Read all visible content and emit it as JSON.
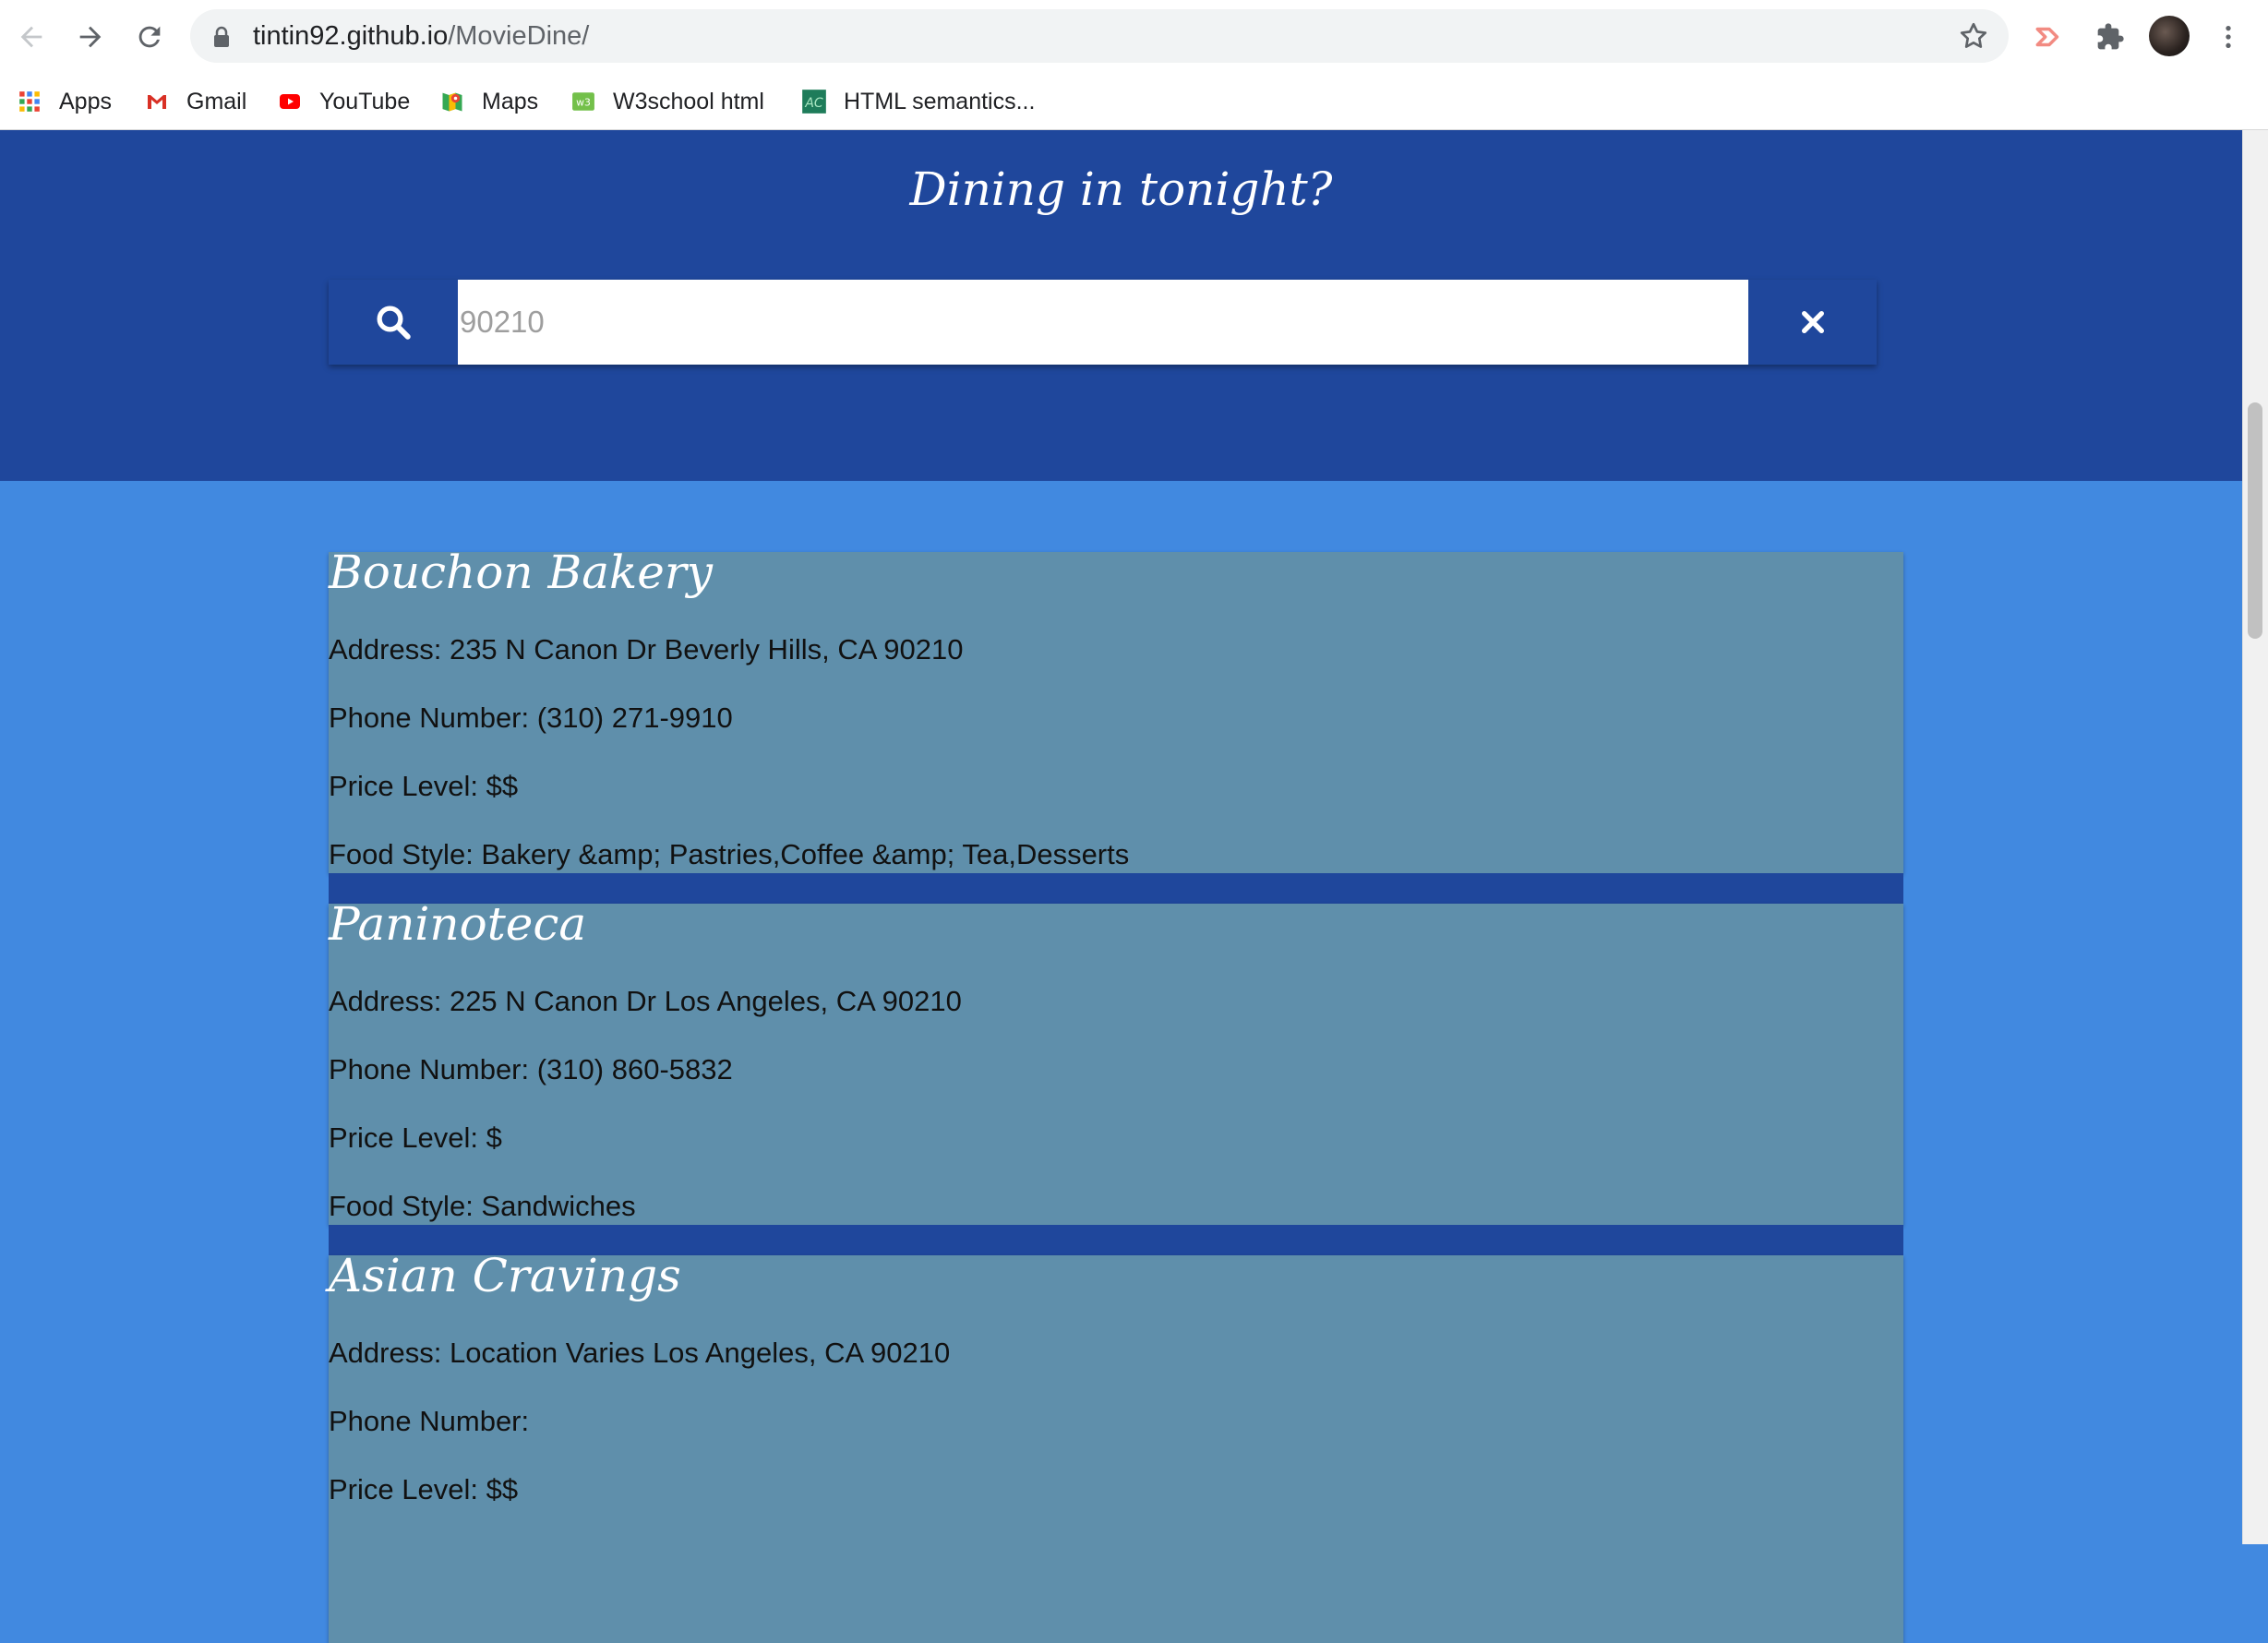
{
  "browser": {
    "url_host": "tintin92.github.io",
    "url_path": "/MovieDine/",
    "bookmarks": [
      {
        "label": "Apps",
        "icon": "apps-grid-icon"
      },
      {
        "label": "Gmail",
        "icon": "gmail-icon"
      },
      {
        "label": "YouTube",
        "icon": "youtube-icon"
      },
      {
        "label": "Maps",
        "icon": "maps-icon"
      },
      {
        "label": "W3school html",
        "icon": "w3schools-icon"
      },
      {
        "label": "HTML semantics...",
        "icon": "html-semantics-icon"
      }
    ]
  },
  "page": {
    "title": "Dining in tonight?",
    "search": {
      "placeholder": "90210",
      "value": ""
    },
    "colors": {
      "header": "#1f479c",
      "background": "#4189e0",
      "card": "#5f8fab"
    }
  },
  "results": [
    {
      "name": "Bouchon Bakery",
      "address": "Address: 235 N Canon Dr Beverly Hills, CA 90210",
      "phone": "Phone Number: (310) 271-9910",
      "price": "Price Level: $$",
      "style": "Food Style: Bakery &amp; Pastries,Coffee &amp; Tea,Desserts"
    },
    {
      "name": "Paninoteca",
      "address": "Address: 225 N Canon Dr Los Angeles, CA 90210",
      "phone": "Phone Number: (310) 860-5832",
      "price": "Price Level: $",
      "style": "Food Style: Sandwiches"
    },
    {
      "name": "Asian Cravings",
      "address": "Address: Location Varies Los Angeles, CA 90210",
      "phone": "Phone Number:",
      "price": "Price Level: $$",
      "style": ""
    }
  ]
}
